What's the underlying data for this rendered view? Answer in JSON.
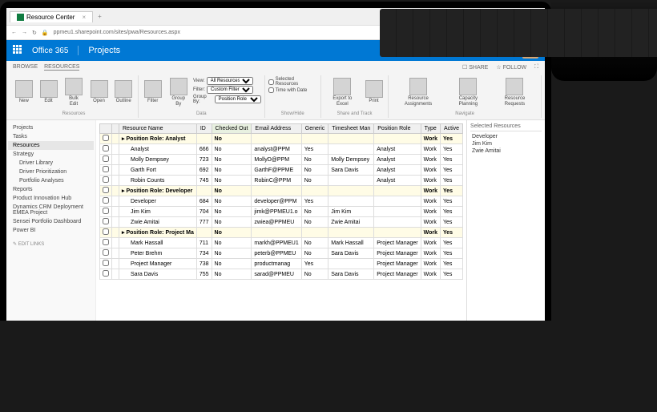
{
  "browser": {
    "tab_title": "Resource Center",
    "url": "ppmeu1.sharepoint.com/sites/pwa/Resources.aspx"
  },
  "o365": {
    "brand": "Office 365",
    "app": "Projects"
  },
  "sharebar": {
    "browse": "BROWSE",
    "resources": "RESOURCES",
    "share": "SHARE",
    "follow": "FOLLOW"
  },
  "ribbon": {
    "groups": [
      {
        "title": "Resources",
        "items": [
          {
            "l": "New"
          },
          {
            "l": "Edit"
          },
          {
            "l": "Bulk Edit"
          },
          {
            "l": "Open"
          },
          {
            "l": "Outline"
          }
        ]
      },
      {
        "title": "Data",
        "items": [
          {
            "l": "Filter"
          },
          {
            "l": "Group By"
          }
        ],
        "extras": {
          "view_label": "View:",
          "view_value": "All Resources",
          "filter_label": "Filter:",
          "filter_value": "Custom Filter...",
          "group_label": "Group By:",
          "group_value": "Position Role"
        }
      },
      {
        "title": "Show/Hide",
        "checks": [
          {
            "l": "Selected Resources"
          },
          {
            "l": "Time with Date"
          }
        ]
      },
      {
        "title": "Share and Track",
        "items": [
          {
            "l": "Export to Excel"
          },
          {
            "l": "Print"
          }
        ]
      },
      {
        "title": "Navigate",
        "items": [
          {
            "l": "Resource Assignments"
          },
          {
            "l": "Capacity Planning"
          },
          {
            "l": "Resource Requests"
          }
        ]
      }
    ]
  },
  "leftnav": [
    {
      "l": "Projects"
    },
    {
      "l": "Tasks"
    },
    {
      "l": "Resources",
      "sel": true
    },
    {
      "l": "Strategy"
    },
    {
      "l": "Driver Library",
      "sub": true
    },
    {
      "l": "Driver Prioritization",
      "sub": true
    },
    {
      "l": "Portfolio Analyses",
      "sub": true
    },
    {
      "l": "Reports"
    },
    {
      "l": "Product Innovation Hub"
    },
    {
      "l": "Dynamics CRM Deployment EMEA Project"
    },
    {
      "l": "Sensei Portfolio Dashboard"
    },
    {
      "l": "Power BI"
    }
  ],
  "edit_links": "EDIT LINKS",
  "columns": [
    "",
    "",
    "Resource Name",
    "ID",
    "Checked Out",
    "Email Address",
    "Generic",
    "Timesheet Man",
    "Position Role",
    "Type",
    "Active"
  ],
  "groups": [
    {
      "title": "Position Role: Analyst",
      "checked": "No",
      "type": "Work",
      "active": "Yes",
      "rows": [
        {
          "n": "Analyst",
          "id": "666",
          "co": "No",
          "em": "analyst@PPM",
          "g": "Yes",
          "tm": "",
          "pr": "Analyst",
          "t": "Work",
          "a": "Yes"
        },
        {
          "n": "Molly Dempsey",
          "id": "723",
          "co": "No",
          "em": "MollyD@PPM",
          "g": "No",
          "tm": "Molly Dempsey",
          "pr": "Analyst",
          "t": "Work",
          "a": "Yes"
        },
        {
          "n": "Garth Fort",
          "id": "692",
          "co": "No",
          "em": "GarthF@PPME",
          "g": "No",
          "tm": "Sara Davis",
          "pr": "Analyst",
          "t": "Work",
          "a": "Yes"
        },
        {
          "n": "Robin Counts",
          "id": "745",
          "co": "No",
          "em": "RobinC@PPM",
          "g": "No",
          "tm": "",
          "pr": "Analyst",
          "t": "Work",
          "a": "Yes"
        }
      ]
    },
    {
      "title": "Position Role: Developer",
      "checked": "No",
      "type": "Work",
      "active": "Yes",
      "rows": [
        {
          "n": "Developer",
          "id": "684",
          "co": "No",
          "em": "developer@PPM",
          "g": "Yes",
          "tm": "",
          "pr": "",
          "t": "Work",
          "a": "Yes"
        },
        {
          "n": "Jim Kim",
          "id": "704",
          "co": "No",
          "em": "jimk@PPMEU1.o",
          "g": "No",
          "tm": "Jim Kim",
          "pr": "",
          "t": "Work",
          "a": "Yes"
        },
        {
          "n": "Zwie Amitai",
          "id": "777",
          "co": "No",
          "em": "zwiea@PPMEU",
          "g": "No",
          "tm": "Zwie Amitai",
          "pr": "",
          "t": "Work",
          "a": "Yes"
        }
      ]
    },
    {
      "title": "Position Role: Project Ma",
      "checked": "No",
      "type": "Work",
      "active": "Yes",
      "rows": [
        {
          "n": "Mark Hassall",
          "id": "711",
          "co": "No",
          "em": "markh@PPMEU1",
          "g": "No",
          "tm": "Mark Hassall",
          "pr": "Project Manager",
          "t": "Work",
          "a": "Yes"
        },
        {
          "n": "Peter Brehm",
          "id": "734",
          "co": "No",
          "em": "peterb@PPMEU",
          "g": "No",
          "tm": "Sara Davis",
          "pr": "Project Manager",
          "t": "Work",
          "a": "Yes"
        },
        {
          "n": "Project Manager",
          "id": "738",
          "co": "No",
          "em": "productmanag",
          "g": "Yes",
          "tm": "",
          "pr": "Project Manager",
          "t": "Work",
          "a": "Yes"
        },
        {
          "n": "Sara Davis",
          "id": "755",
          "co": "No",
          "em": "sarad@PPMEU",
          "g": "No",
          "tm": "Sara Davis",
          "pr": "Project Manager",
          "t": "Work",
          "a": "Yes"
        }
      ]
    }
  ],
  "selected_panel": {
    "title": "Selected Resources",
    "items": [
      "Developer",
      "Jim Kim",
      "Zwie Amitai"
    ]
  }
}
